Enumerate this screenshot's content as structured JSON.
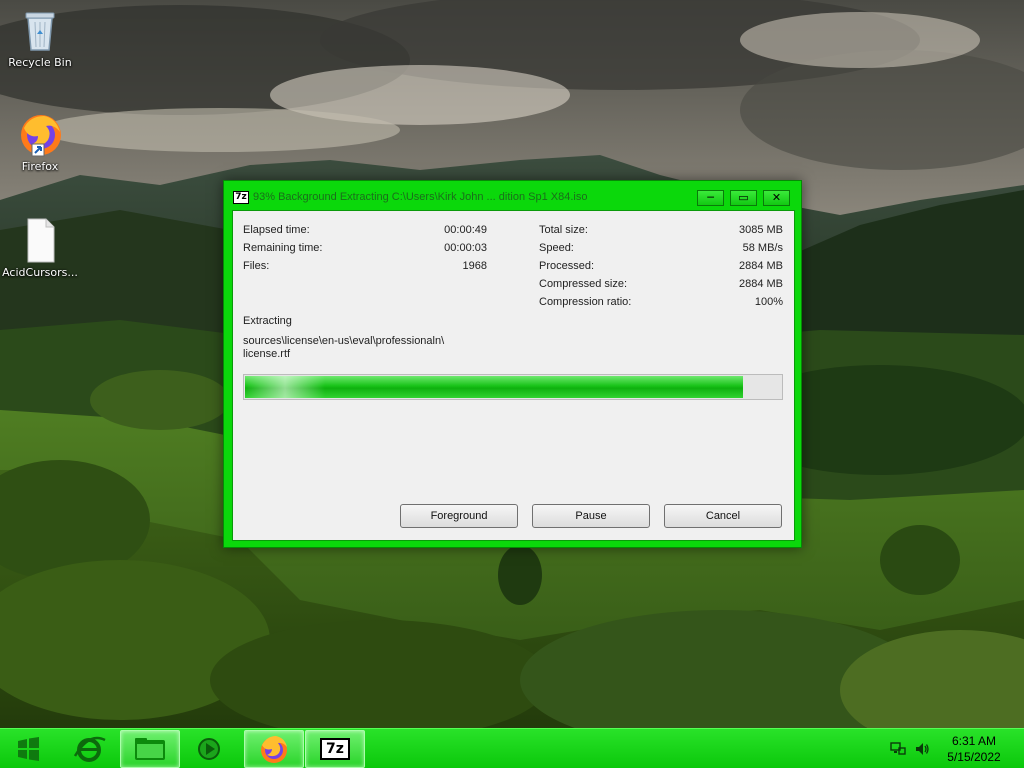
{
  "desktop": {
    "icons": [
      {
        "label": "Recycle Bin",
        "icon": "recycle-bin-icon"
      },
      {
        "label": "Firefox",
        "icon": "firefox-icon"
      },
      {
        "label": "AcidCursors...",
        "icon": "file-icon"
      }
    ]
  },
  "window": {
    "app_icon_text": "7z",
    "title": "93% Background Extracting C:\\Users\\Kirk John ... dition Sp1 X84.iso",
    "controls": {
      "minimize": "─",
      "maximize": "▭",
      "close": "✕"
    },
    "stats_left": [
      {
        "label": "Elapsed time:",
        "value": "00:00:49"
      },
      {
        "label": "Remaining time:",
        "value": "00:00:03"
      },
      {
        "label": "Files:",
        "value": "1968"
      }
    ],
    "stats_right": [
      {
        "label": "Total size:",
        "value": "3085 MB"
      },
      {
        "label": "Speed:",
        "value": "58 MB/s"
      },
      {
        "label": "Processed:",
        "value": "2884 MB"
      },
      {
        "label": "Compressed size:",
        "value": "2884 MB"
      },
      {
        "label": "Compression ratio:",
        "value": "100%"
      }
    ],
    "action_label": "Extracting",
    "current_path_line1": "sources\\license\\en-us\\eval\\professionaln\\",
    "current_path_line2": "license.rtf",
    "progress_fraction": 0.93,
    "buttons": {
      "foreground": "Foreground",
      "pause": "Pause",
      "cancel": "Cancel"
    }
  },
  "taskbar": {
    "items": [
      {
        "name": "start-button",
        "icon": "windows-logo-icon"
      },
      {
        "name": "internet-explorer",
        "icon": "internet-explorer-icon"
      },
      {
        "name": "file-explorer",
        "icon": "folder-icon"
      },
      {
        "name": "media-player",
        "icon": "media-player-icon"
      },
      {
        "name": "firefox",
        "icon": "firefox-icon"
      },
      {
        "name": "7zip",
        "icon": "7zip-icon",
        "text": "7z"
      }
    ],
    "clock": {
      "time": "6:31 AM",
      "date": "5/15/2022"
    }
  },
  "colors": {
    "theme_green": "#0bd80b",
    "progress_green": "#18c318"
  }
}
